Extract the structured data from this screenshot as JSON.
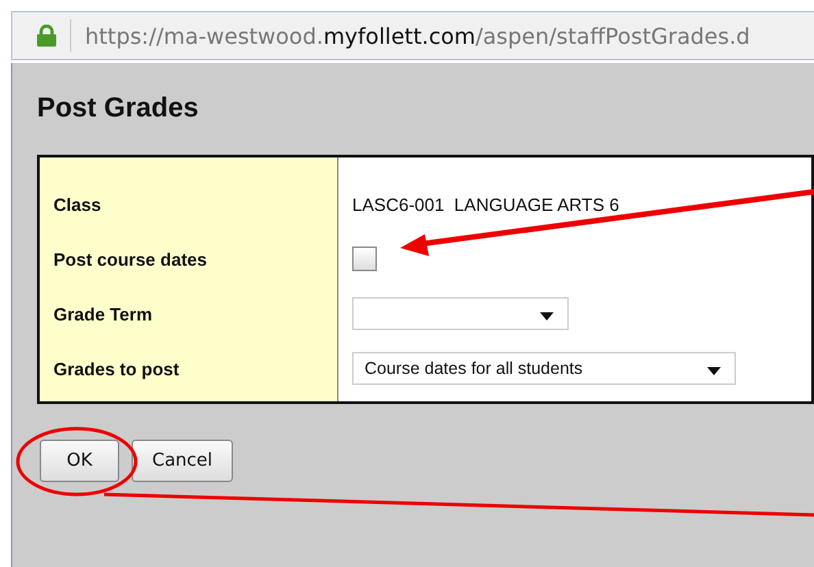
{
  "address_bar": {
    "secure": true,
    "url_prefix": "https://ma-westwood.",
    "url_domain": "myfollett.com",
    "url_path": "/aspen/staffPostGrades.d"
  },
  "dialog": {
    "title": "Post Grades",
    "fields": [
      {
        "kind": "text",
        "label": "Class",
        "value": "LASC6-001  LANGUAGE ARTS 6"
      },
      {
        "kind": "checkbox",
        "label": "Post course dates",
        "checked": false
      },
      {
        "kind": "select",
        "label": "Grade Term"
      },
      {
        "kind": "select",
        "label": "Grades to post",
        "value": "Course dates for all students"
      }
    ],
    "buttons": [
      {
        "label": "OK"
      },
      {
        "label": "Cancel"
      }
    ]
  }
}
